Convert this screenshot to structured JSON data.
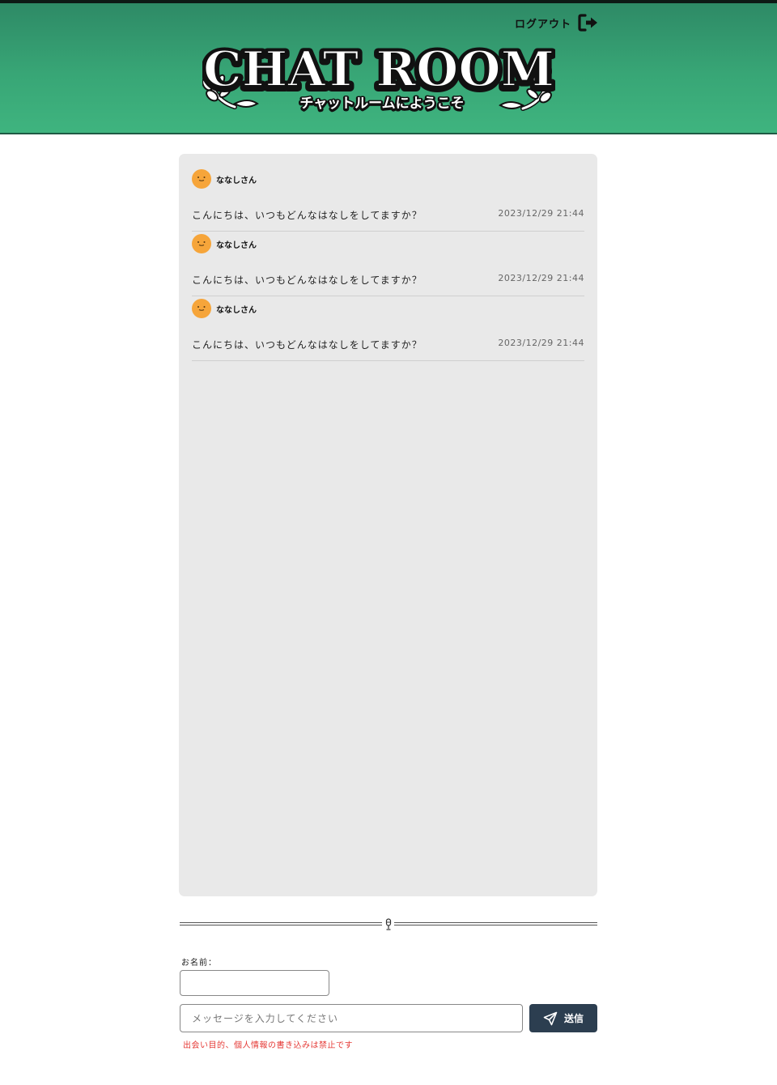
{
  "header": {
    "logout_label": "ログアウト",
    "logout_icon": "sign-out-icon",
    "logo_title": "CHAT ROOM",
    "logo_subtitle": "チャットルームにようこそ",
    "background_color": "#3aa877"
  },
  "messages": [
    {
      "avatar_icon": "smiley-face-icon",
      "name": "ななしさん",
      "text": "こんにちは、いつもどんなはなしをしてますか？",
      "time": "2023/12/29 21:44"
    },
    {
      "avatar_icon": "smiley-face-icon",
      "name": "ななしさん",
      "text": "こんにちは、いつもどんなはなしをしてますか？",
      "time": "2023/12/29 21:44"
    },
    {
      "avatar_icon": "smiley-face-icon",
      "name": "ななしさん",
      "text": "こんにちは、いつもどんなはなしをしてますか？",
      "time": "2023/12/29 21:44"
    }
  ],
  "form": {
    "name_label": "お名前：",
    "name_value": "",
    "message_placeholder": "メッセージを入力してください",
    "message_value": "",
    "send_label": "送信",
    "send_icon": "paper-plane-icon",
    "warning": "出会い目的、個人情報の書き込みは禁止です",
    "send_button_color": "#2c3e50",
    "warning_color": "#e53935"
  },
  "divider_icon": "microphone-icon"
}
